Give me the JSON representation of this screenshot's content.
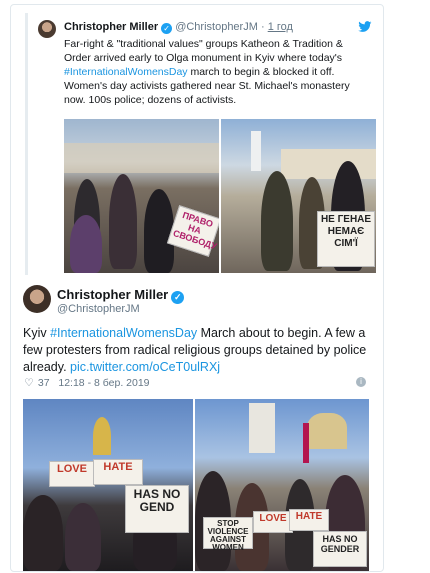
{
  "quoted_tweet": {
    "author_name": "Christopher Miller",
    "verified_glyph": "✓",
    "author_handle": "@ChristopherJM",
    "separator": "·",
    "time": "1 год",
    "text_before": "Far-right & \"traditional values\" groups Katheon & Tradition & Order arrived early to Olga monument in Kyiv where today's ",
    "hashtag": "#InternationalWomensDay",
    "text_after": " march to begin & blocked it off. Women's day activists gathered near St. Michael's monastery now. 100s police; dozens of activists.",
    "photo_left_sign": "ПРАВО НА СВОБОДУ",
    "photo_right_sign": "НЕ ГЕНАЕ НЕМАЄ СІМ'Ї"
  },
  "main_tweet": {
    "author_name": "Christopher Miller",
    "verified_glyph": "✓",
    "author_handle": "@ChristopherJM",
    "text_start": "Kyiv ",
    "hashtag": "#InternationalWomensDay",
    "text_mid": " March about to begin. A few a few protesters from radical religious groups detained by police already. ",
    "link": "pic.twitter.com/oCeT0ulRXj",
    "likes": "37",
    "datetime": "12:18 - 8 бер. 2019",
    "info_glyph": "i",
    "photo_left_signs": [
      "LOVE",
      "HATE",
      "HAS NO GEND"
    ],
    "photo_right_signs": [
      "STOP VIOLENCE AGAINST WOMEN",
      "LOVE",
      "HATE",
      "HAS NO GENDER"
    ]
  },
  "colors": {
    "link": "#1b95e0",
    "verified": "#1da1f2",
    "muted": "#657786"
  }
}
